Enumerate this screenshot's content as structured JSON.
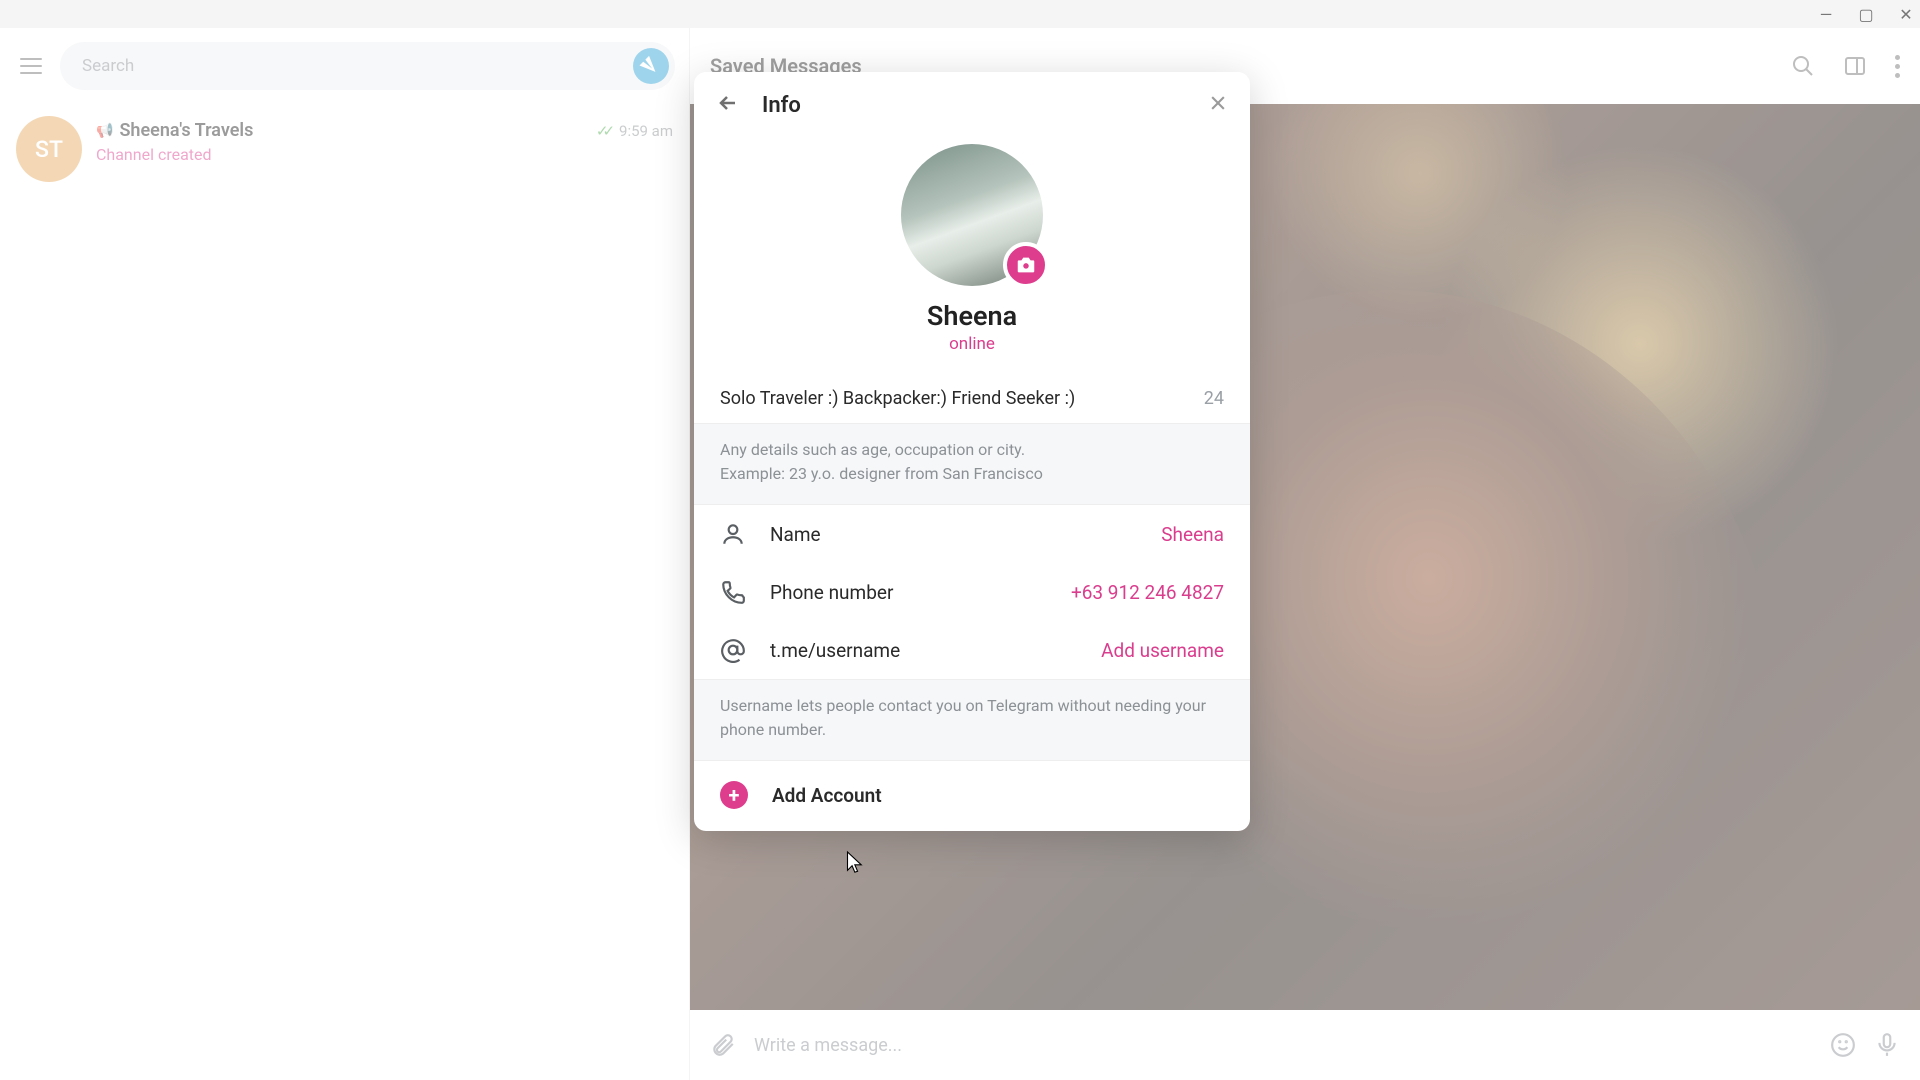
{
  "window": {
    "title": ""
  },
  "left": {
    "search_placeholder": "Search",
    "chat": {
      "avatar_initials": "ST",
      "title": "Sheena's Travels",
      "subtitle": "Channel created",
      "time": "9:59 am"
    }
  },
  "right": {
    "header_title": "Saved Messages",
    "composer_placeholder": "Write a message..."
  },
  "modal": {
    "title": "Info",
    "profile_name": "Sheena",
    "profile_status": "online",
    "bio_text": "Solo Traveler :) Backpacker:) Friend Seeker :)",
    "bio_count": "24",
    "bio_hint_line1": "Any details such as age, occupation or city.",
    "bio_hint_line2": "Example: 23 y.o. designer from San Francisco",
    "rows": {
      "name_label": "Name",
      "name_value": "Sheena",
      "phone_label": "Phone number",
      "phone_value": "+63 912 246 4827",
      "username_label": "t.me/username",
      "username_value": "Add username"
    },
    "username_hint": "Username lets people contact you on Telegram without needing your phone number.",
    "add_account_label": "Add Account"
  }
}
